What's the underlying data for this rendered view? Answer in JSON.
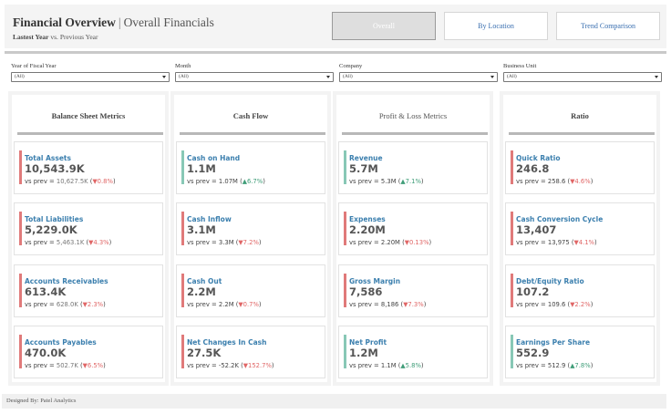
{
  "header": {
    "title": "Financial Overview",
    "separator": "|",
    "subtitle_main": "Overall Financials",
    "period_current": "Lastest Year",
    "period_vs": "vs.",
    "period_previous": "Previous Year"
  },
  "nav": {
    "overall": "Overall",
    "by_location": "By Location",
    "trend_comparison": "Trend Comparison",
    "active": "overall"
  },
  "filters": [
    {
      "label": "Year of Fiscal Year",
      "value": "(All)"
    },
    {
      "label": "Month",
      "value": "(All)"
    },
    {
      "label": "Company",
      "value": "(All)"
    },
    {
      "label": "Business Unit",
      "value": "(All)"
    }
  ],
  "columns": [
    {
      "title": "Balance Sheet Metrics",
      "metrics": [
        {
          "name": "Total Assets",
          "value": "10,543.9K",
          "prev_label": "vs prev = ",
          "prev": "10,627.5K",
          "change": "▼0.8%",
          "direction": "down"
        },
        {
          "name": "Total Liabilities",
          "value": "5,229.0K",
          "prev_label": "vs prev = ",
          "prev": "5,463.1K",
          "change": "▼4.3%",
          "direction": "down"
        },
        {
          "name": "Accounts Receivables",
          "value": "613.4K",
          "prev_label": "vs prev = ",
          "prev": "628.0K",
          "change": "▼2.3%",
          "direction": "down"
        },
        {
          "name": "Accounts Payables",
          "value": "470.0K",
          "prev_label": "vs prev = ",
          "prev": "502.7K",
          "change": "▼6.5%",
          "direction": "down"
        }
      ]
    },
    {
      "title": "Cash Flow",
      "metrics": [
        {
          "name": "Cash on Hand",
          "value": "1.1M",
          "prev_label": "vs prev = ",
          "prev": "1.07M",
          "change": "▲6.7%",
          "direction": "up"
        },
        {
          "name": "Cash Inflow",
          "value": "3.1M",
          "prev_label": "vs prev = ",
          "prev": "3.3M",
          "change": "▼7.2%",
          "direction": "down"
        },
        {
          "name": "Cash Out",
          "value": "2.2M",
          "prev_label": "vs prev = ",
          "prev": "2.2M",
          "change": "▼0.7%",
          "direction": "down"
        },
        {
          "name": "Net Changes In Cash",
          "value": "27.5K",
          "prev_label": "vs prev = ",
          "prev": "-52.2K",
          "change": "▼152.7%",
          "direction": "down"
        }
      ]
    },
    {
      "title": "Profit & Loss Metrics",
      "metrics": [
        {
          "name": "Revenue",
          "value": "5.7M",
          "prev_label": "vs prev = ",
          "prev": "5.3M",
          "change": "▲7.1%",
          "direction": "up"
        },
        {
          "name": "Expenses",
          "value": "2.20M",
          "prev_label": "vs prev = ",
          "prev": "2.20M",
          "change": "▼0.13%",
          "direction": "down"
        },
        {
          "name": "Gross Margin",
          "value": "7,586",
          "prev_label": "vs prev = ",
          "prev": "8,186",
          "change": "▼7.3%",
          "direction": "down"
        },
        {
          "name": "Net Profit",
          "value": "1.2M",
          "prev_label": "vs prev = ",
          "prev": "1.1M",
          "change": "▲5.8%",
          "direction": "up"
        }
      ]
    },
    {
      "title": "Ratio",
      "metrics": [
        {
          "name": "Quick Ratio",
          "value": "246.8",
          "prev_label": "vs prev = ",
          "prev": "258.6",
          "change": "▼4.6%",
          "direction": "down"
        },
        {
          "name": "Cash Conversion Cycle",
          "value": "13,407",
          "prev_label": "vs prev = ",
          "prev": "13,975",
          "change": "▼4.1%",
          "direction": "down"
        },
        {
          "name": "Debt/Equity Ratio",
          "value": "107.2",
          "prev_label": "vs prev = ",
          "prev": "109.6",
          "change": "▼2.2%",
          "direction": "down"
        },
        {
          "name": "Earnings Per Share",
          "value": "552.9",
          "prev_label": "vs prev = ",
          "prev": "512.9",
          "change": "▲7.8%",
          "direction": "up"
        }
      ]
    }
  ],
  "footer": {
    "text": "Designed By: Patel Analytics"
  },
  "colors": {
    "down": "#e06666",
    "up": "#3f9d78",
    "metric_name": "#3b7fae",
    "bar_down": "#e07a7a",
    "bar_up": "#88c8b6"
  }
}
